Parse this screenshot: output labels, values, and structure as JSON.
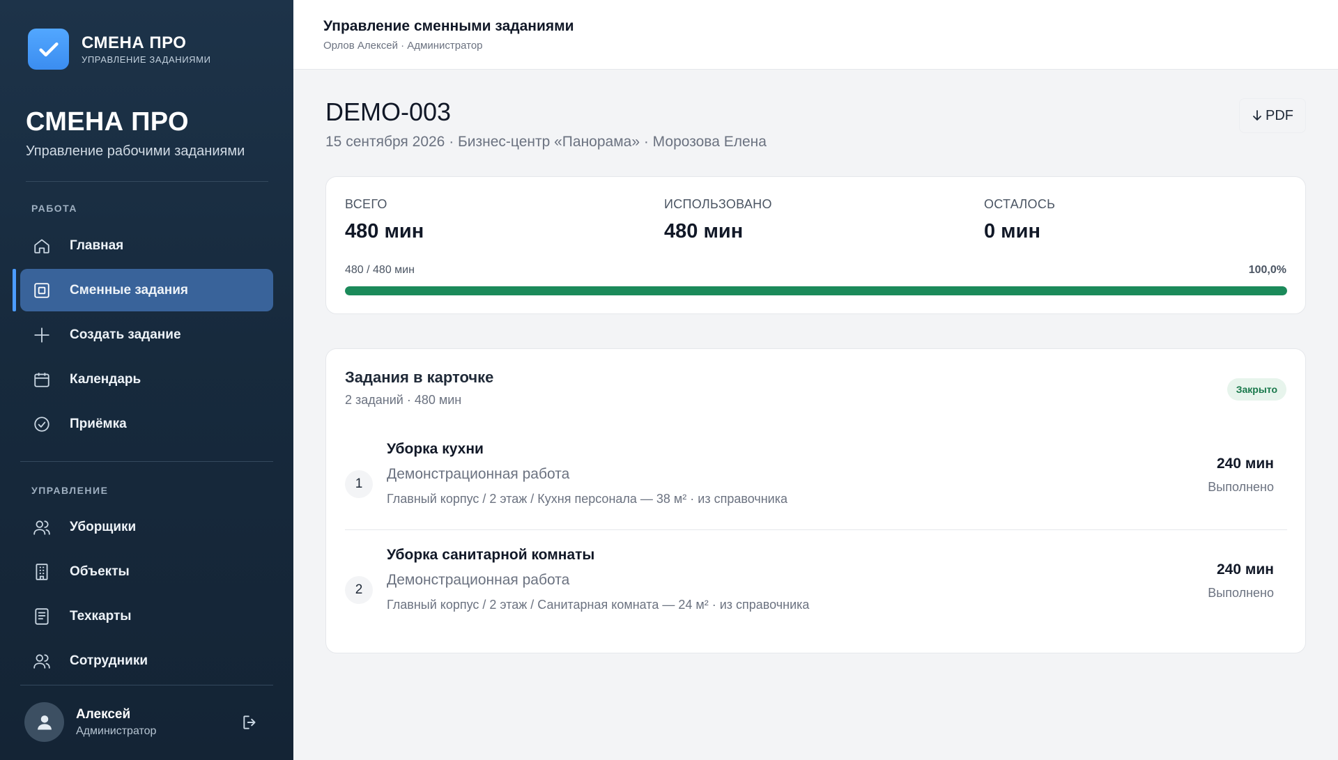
{
  "brand": {
    "name": "СМЕНА ПРО",
    "subtitle": "УПРАВЛЕНИЕ ЗАДАНИЯМИ"
  },
  "sidebar": {
    "title": "СМЕНА ПРО",
    "subtitle": "Управление рабочими заданиями",
    "sections": [
      {
        "label": "РАБОТА",
        "items": [
          {
            "label": "Главная",
            "icon": "home-icon",
            "active": false
          },
          {
            "label": "Сменные задания",
            "icon": "clipboard-icon",
            "active": true
          },
          {
            "label": "Создать задание",
            "icon": "plus-icon",
            "active": false
          },
          {
            "label": "Календарь",
            "icon": "calendar-icon",
            "active": false
          },
          {
            "label": "Приёмка",
            "icon": "check-circle-icon",
            "active": false
          }
        ]
      },
      {
        "label": "УПРАВЛЕНИЕ",
        "items": [
          {
            "label": "Уборщики",
            "icon": "users-icon",
            "active": false
          },
          {
            "label": "Объекты",
            "icon": "building-icon",
            "active": false
          },
          {
            "label": "Техкарты",
            "icon": "document-icon",
            "active": false
          },
          {
            "label": "Сотрудники",
            "icon": "users-icon",
            "active": false
          }
        ]
      }
    ],
    "user": {
      "name": "Алексей",
      "role": "Администратор"
    }
  },
  "topbar": {
    "title": "Управление сменными заданиями",
    "subtitle": "Орлов Алексей · Администратор"
  },
  "card": {
    "title": "DEMO-003",
    "meta": "15 сентября 2026 · Бизнес-центр «Панорама» · Морозова Елена",
    "pdf_label": "PDF"
  },
  "summary": {
    "total_label": "ВСЕГО",
    "total_value": "480 мин",
    "used_label": "ИСПОЛЬЗОВАНО",
    "used_value": "480 мин",
    "left_label": "ОСТАЛОСЬ",
    "left_value": "0 мин",
    "progress_text": "480 / 480 мин",
    "progress_percent_text": "100,0%",
    "progress_fraction": 1.0
  },
  "tasks": {
    "title": "Задания в карточке",
    "subtitle": "2 заданий · 480 мин",
    "status_badge": "Закрыто",
    "items": [
      {
        "num": "1",
        "name": "Уборка кухни",
        "type": "Демонстрационная работа",
        "location": "Главный корпус / 2 этаж / Кухня персонала — 38 м² · из справочника",
        "duration": "240 мин",
        "status": "Выполнено"
      },
      {
        "num": "2",
        "name": "Уборка санитарной комнаты",
        "type": "Демонстрационная работа",
        "location": "Главный корпус / 2 этаж / Санитарная комната — 24 м² · из справочника",
        "duration": "240 мин",
        "status": "Выполнено"
      }
    ]
  },
  "colors": {
    "sidebar_bg": "#1d3349",
    "active_nav": "#39639a",
    "accent_blue": "#4c9cff",
    "progress_green": "#1b8a5a",
    "badge_bg": "#e7f4ec",
    "badge_text": "#19784b"
  }
}
